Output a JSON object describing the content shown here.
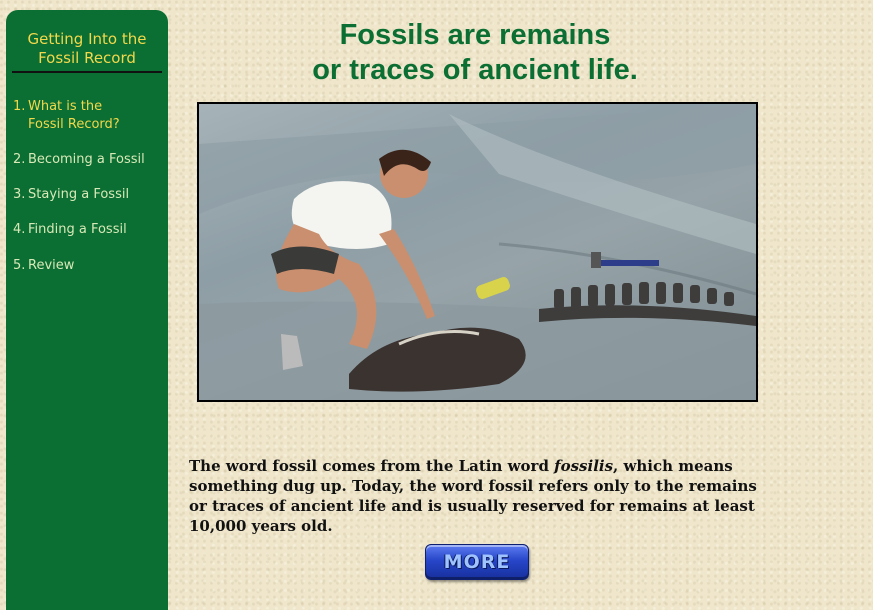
{
  "sidebar": {
    "title_line1": "Getting Into the",
    "title_line2": "Fossil Record",
    "items": [
      {
        "num": "1.",
        "label_line1": "What is the",
        "label_line2": "Fossil Record?"
      },
      {
        "num": "2.",
        "label": "Becoming a Fossil"
      },
      {
        "num": "3.",
        "label": "Staying a Fossil"
      },
      {
        "num": "4.",
        "label": "Finding a Fossil"
      },
      {
        "num": "5.",
        "label": "Review"
      }
    ]
  },
  "main": {
    "headline_line1": "Fossils are remains",
    "headline_line2": "or traces of ancient life.",
    "body_part1": "The word fossil comes from the Latin word ",
    "body_italic": "fossilis",
    "body_part2": ", which means something dug up. Today, the word fossil refers only to the remains or traces of ancient life and is usually reserved for remains at least 10,000 years old.",
    "more_button": "MORE"
  },
  "colors": {
    "sidebar_green": "#0b6e32",
    "nav_yellow": "#f2d84c",
    "headline_green": "#0b6e32",
    "background_tan": "#efe6cc",
    "button_blue": "#2746c9"
  }
}
